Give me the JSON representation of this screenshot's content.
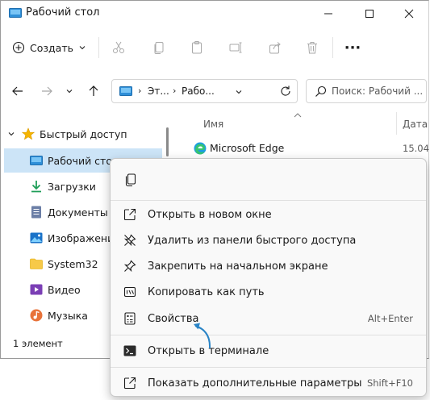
{
  "window": {
    "title": "Рабочий стол",
    "controls": [
      "minimize",
      "maximize",
      "close"
    ]
  },
  "toolbar": {
    "create_label": "Создать",
    "icons": [
      "cut-icon",
      "copy-icon",
      "paste-icon",
      "rename-icon",
      "share-icon",
      "delete-icon",
      "more-icon"
    ],
    "more_label": "···"
  },
  "address": {
    "crumb1": "Эт...",
    "crumb2": "Рабо...",
    "search_placeholder": "Поиск: Рабочий ..."
  },
  "sidebar": {
    "items": [
      {
        "label": "Быстрый доступ",
        "icon": "star-icon"
      },
      {
        "label": "Рабочий стол",
        "icon": "desktop-icon"
      },
      {
        "label": "Загрузки",
        "icon": "download-icon"
      },
      {
        "label": "Документы",
        "icon": "documents-icon"
      },
      {
        "label": "Изображения",
        "icon": "pictures-icon"
      },
      {
        "label": "System32",
        "icon": "folder-icon"
      },
      {
        "label": "Видео",
        "icon": "videos-icon"
      },
      {
        "label": "Музыка",
        "icon": "music-icon"
      }
    ]
  },
  "content": {
    "col_name": "Имя",
    "col_date": "Дата",
    "rows": [
      {
        "name": "Microsoft Edge",
        "date": "15.04"
      }
    ]
  },
  "status": {
    "count": "1 элемент"
  },
  "context_menu": {
    "items": [
      {
        "label": "Открыть в новом окне",
        "shortcut": ""
      },
      {
        "label": "Удалить из панели быстрого доступа",
        "shortcut": ""
      },
      {
        "label": "Закрепить на начальном экране",
        "shortcut": ""
      },
      {
        "label": "Копировать как путь",
        "shortcut": ""
      },
      {
        "label": "Свойства",
        "shortcut": "Alt+Enter"
      },
      {
        "label": "Открыть в терминале",
        "shortcut": ""
      },
      {
        "label": "Показать дополнительные параметры",
        "shortcut": "Shift+F10"
      }
    ]
  },
  "colors": {
    "selection": "#cce4f7",
    "accent": "#0067c0",
    "annotation_arrow": "#2a84c6"
  }
}
